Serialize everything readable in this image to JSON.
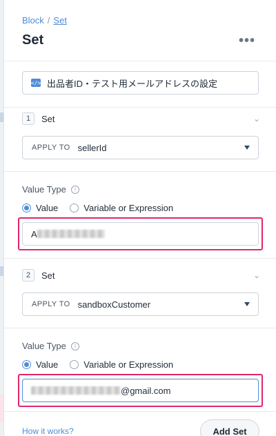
{
  "breadcrumb": {
    "parent": "Block",
    "separator": "/",
    "current": "Set"
  },
  "header": {
    "title": "Set",
    "more": "•••"
  },
  "comment": {
    "text": "出品者ID・テスト用メールアドレスの設定",
    "icon": "code-icon"
  },
  "steps": [
    {
      "number": "1",
      "label": "Set",
      "apply_to_label": "APPLY TO",
      "apply_to_value": "sellerId",
      "value_type_label": "Value Type",
      "options": [
        "Value",
        "Variable or Expression"
      ],
      "selected": "Value",
      "input_prefix": "A",
      "input_suffix": ""
    },
    {
      "number": "2",
      "label": "Set",
      "apply_to_label": "APPLY TO",
      "apply_to_value": "sandboxCustomer",
      "value_type_label": "Value Type",
      "options": [
        "Value",
        "Variable or Expression"
      ],
      "selected": "Value",
      "input_prefix": "",
      "input_suffix": "@gmail.com"
    }
  ],
  "footer": {
    "how_it_works": "How it works?",
    "add_set": "Add Set"
  },
  "colors": {
    "accent": "#4f8cd6",
    "highlight": "#e0266a"
  }
}
